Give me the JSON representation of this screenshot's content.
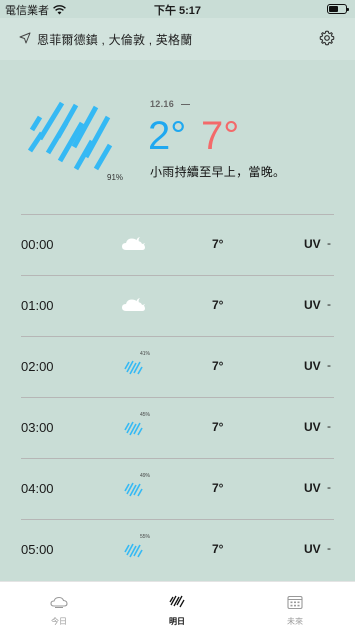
{
  "status_bar": {
    "carrier": "電信業者",
    "time": "下午 5:17"
  },
  "location": {
    "text": "恩菲爾德鎮 , 大倫敦 , 英格蘭"
  },
  "summary": {
    "date": "12.16",
    "precip_percent": "91%",
    "temp_min": "2°",
    "temp_max": "7°",
    "description": "小雨持續至早上，當晚。",
    "icon": "rain-heavy-icon"
  },
  "hours": [
    {
      "time": "00:00",
      "icon": "cloud-night-icon",
      "precip": "",
      "temp": "7°",
      "uv_label": "UV",
      "uv": "-"
    },
    {
      "time": "01:00",
      "icon": "cloud-night-icon",
      "precip": "",
      "temp": "7°",
      "uv_label": "UV",
      "uv": "-"
    },
    {
      "time": "02:00",
      "icon": "rain-icon",
      "precip": "41%",
      "temp": "7°",
      "uv_label": "UV",
      "uv": "-"
    },
    {
      "time": "03:00",
      "icon": "rain-icon",
      "precip": "45%",
      "temp": "7°",
      "uv_label": "UV",
      "uv": "-"
    },
    {
      "time": "04:00",
      "icon": "rain-icon",
      "precip": "49%",
      "temp": "7°",
      "uv_label": "UV",
      "uv": "-"
    },
    {
      "time": "05:00",
      "icon": "rain-icon",
      "precip": "55%",
      "temp": "7°",
      "uv_label": "UV",
      "uv": "-"
    }
  ],
  "tabs": [
    {
      "label": "今日",
      "icon": "cloud-tab-icon",
      "active": false
    },
    {
      "label": "明日",
      "icon": "rain-tab-icon",
      "active": true
    },
    {
      "label": "未來",
      "icon": "calendar-icon",
      "active": false
    }
  ],
  "colors": {
    "background": "#c9ddd6",
    "rain_blue": "#1fa8f0",
    "temp_max_red": "#f36a6a"
  }
}
